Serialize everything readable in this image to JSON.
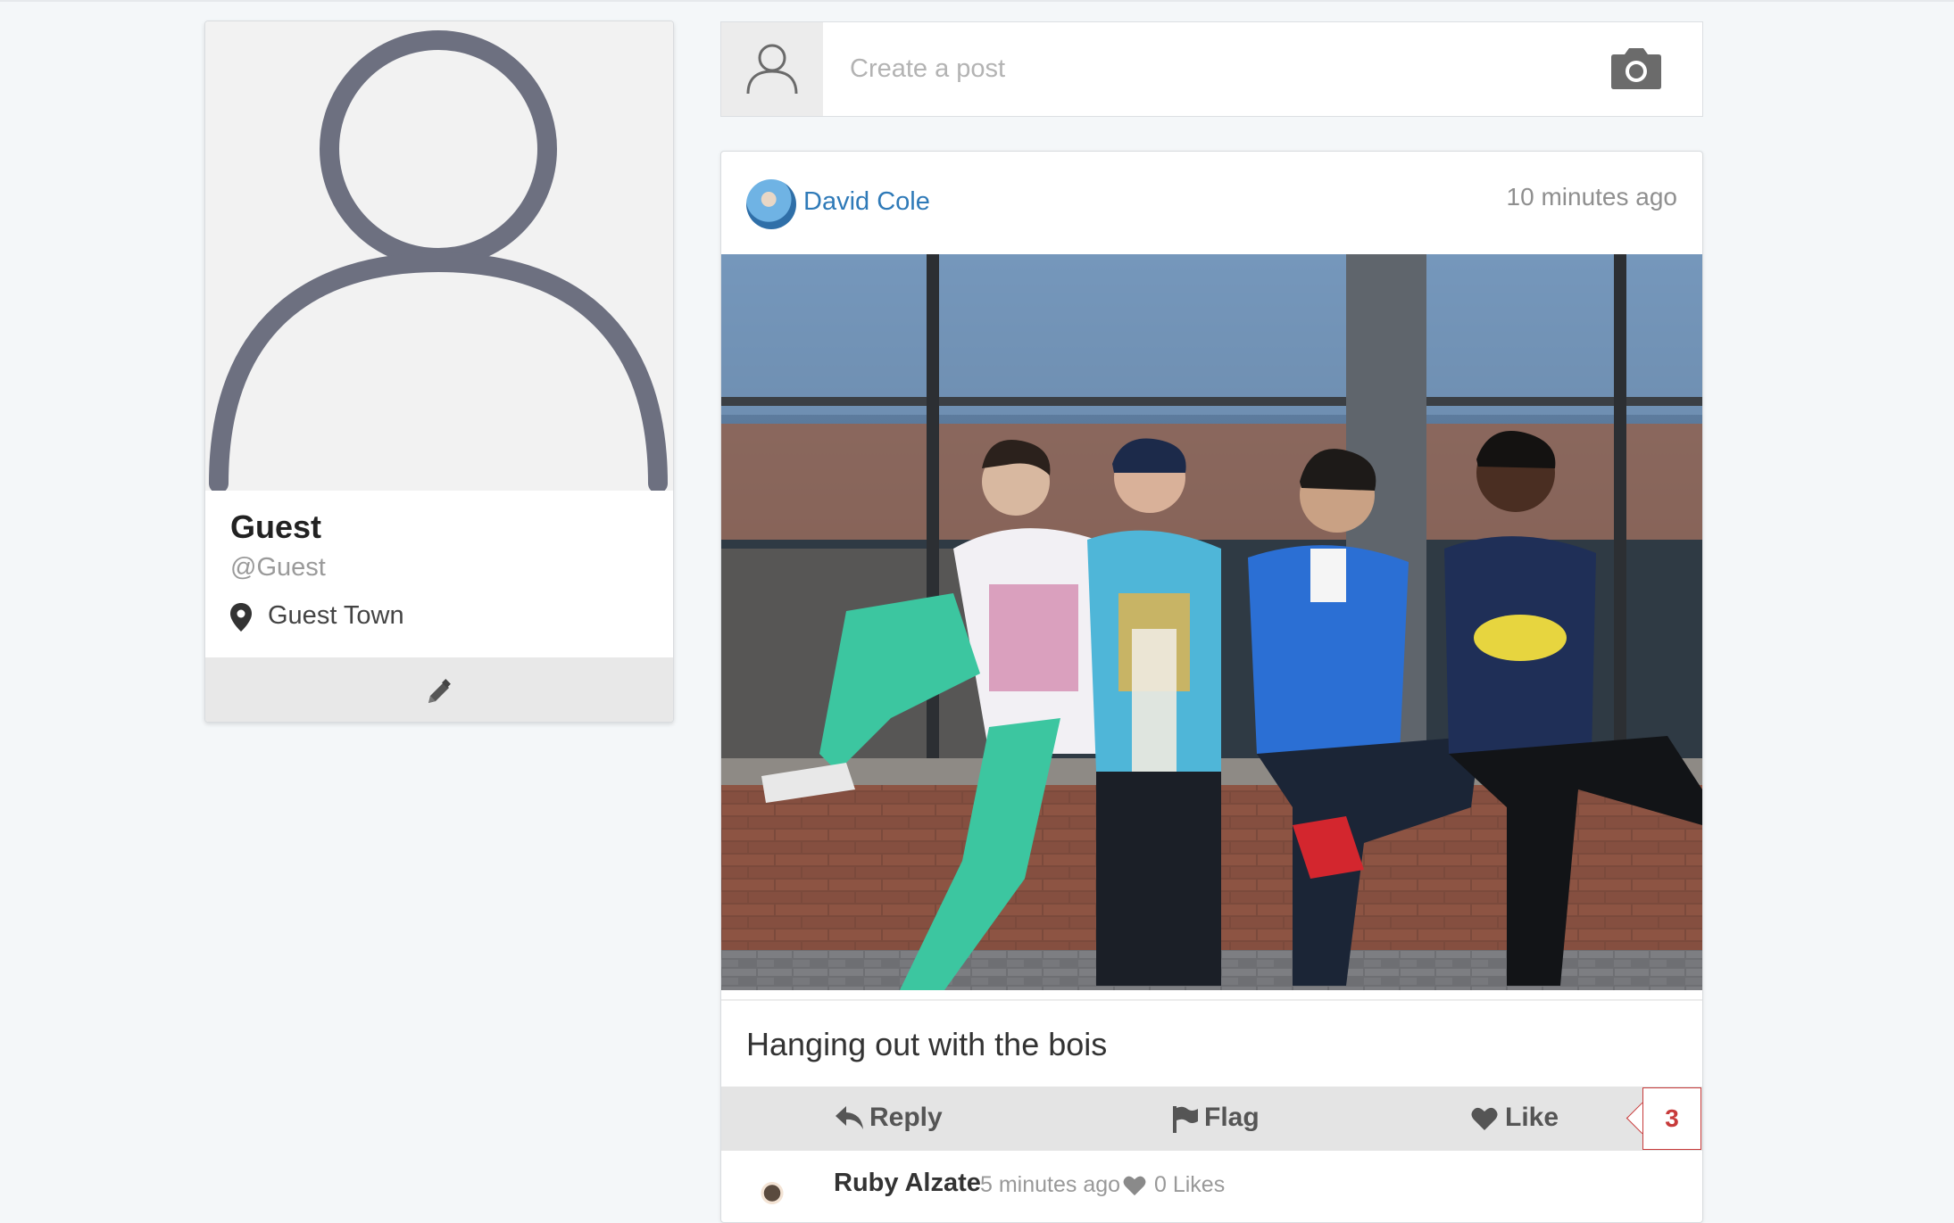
{
  "profile": {
    "name": "Guest",
    "handle": "@Guest",
    "location": "Guest Town",
    "edit_icon": "pencil-icon"
  },
  "composer": {
    "placeholder": "Create a post",
    "avatar_icon": "user-outline-icon",
    "camera_icon": "camera-icon"
  },
  "post": {
    "author": "David Cole",
    "time": "10 minutes ago",
    "caption": "Hanging out with the bois",
    "photo": "photo of four friends sitting on a brick ledge",
    "actions": {
      "reply": "Reply",
      "flag": "Flag",
      "like": "Like"
    },
    "like_count": "3"
  },
  "comment": {
    "author": "Ruby Alzate",
    "time": "5 minutes ago",
    "likes": "0 Likes"
  },
  "colors": {
    "background": "#f4f7f9",
    "link": "#2f7ab8",
    "like_badge": "#c73a3a",
    "avatar_silhouette": "#6d7080"
  }
}
